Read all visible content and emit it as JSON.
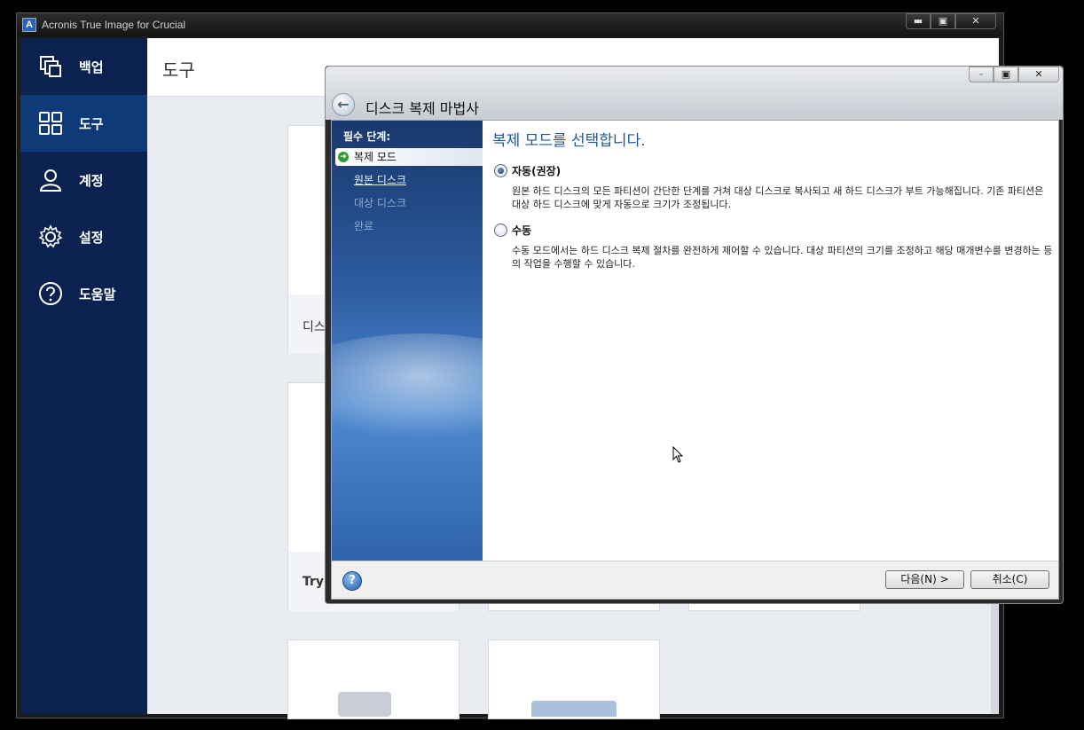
{
  "main_window": {
    "title": "Acronis True Image for Crucial",
    "controls": {
      "minimize": "▬",
      "maximize": "▣",
      "close": "✕"
    }
  },
  "sidebar": {
    "items": [
      {
        "label": "백업",
        "icon": "backup-copy-icon",
        "active": false
      },
      {
        "label": "도구",
        "icon": "tools-grid-icon",
        "active": true
      },
      {
        "label": "계정",
        "icon": "user-icon",
        "active": false
      },
      {
        "label": "설정",
        "icon": "gear-icon",
        "active": false
      },
      {
        "label": "도움말",
        "icon": "help-icon",
        "active": false
      }
    ]
  },
  "content": {
    "title": "도구",
    "tiles": [
      {
        "caption": "디스"
      },
      {
        "caption": "Try"
      }
    ]
  },
  "wizard": {
    "title": "디스크 복제 마법사",
    "back_icon": "back-arrow-icon",
    "steps_heading": "필수 단계:",
    "steps": [
      {
        "label": "복제 모드",
        "state": "current"
      },
      {
        "label": "원본 디스크",
        "state": "link"
      },
      {
        "label": "대상 디스크",
        "state": "disabled"
      },
      {
        "label": "완료",
        "state": "disabled"
      }
    ],
    "heading": "복제 모드를 선택합니다.",
    "options": [
      {
        "label": "자동(권장)",
        "checked": true,
        "description": "원본 하드 디스크의 모든 파티션이 간단한 단계를 거쳐 대상 디스크로 복사되고 새 하드 디스크가 부트 가능해집니다. 기존 파티션은 대상 하드 디스크에 맞게 자동으로 크기가 조정됩니다."
      },
      {
        "label": "수동",
        "checked": false,
        "description": "수동 모드에서는 하드 디스크 복제 절차를 완전하게 제어할 수 있습니다. 대상 파티션의 크기를 조정하고 해당 매개변수를 변경하는 등의 작업을 수행할 수 있습니다."
      }
    ],
    "buttons": {
      "next": "다음(N) >",
      "cancel": "취소(C)",
      "help": "?"
    }
  },
  "colors": {
    "sidebar_bg": "#0b2250",
    "sidebar_active": "#0f3a78",
    "heading_blue": "#1d5a96"
  }
}
